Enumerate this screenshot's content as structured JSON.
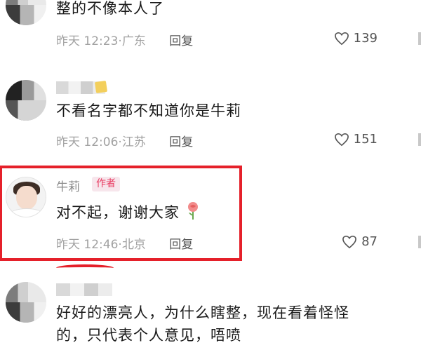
{
  "comments": [
    {
      "text": "整的不像本人了",
      "time": "昨天 12:23",
      "location": "广东",
      "reply_label": "回复",
      "likes": "139"
    },
    {
      "text": "不看名字都不知道你是牛莉",
      "time": "昨天 12:06",
      "location": "江苏",
      "reply_label": "回复",
      "likes": "151"
    },
    {
      "username": "牛莉",
      "badge": "作者",
      "text": "对不起，谢谢大家",
      "time": "昨天 12:46",
      "location": "北京",
      "reply_label": "回复",
      "likes": "87"
    },
    {
      "text_line1": "好好的漂亮人，为什么瞎整，现在看着怪怪",
      "text_line2": "的，只代表个人意见，唔喷"
    }
  ],
  "emoji": "rose-emoji",
  "colors": {
    "highlight": "#e5202a",
    "badge_bg": "#f7e6ec",
    "badge_text": "#e83b61",
    "meta_gray": "#a1a1a1"
  }
}
